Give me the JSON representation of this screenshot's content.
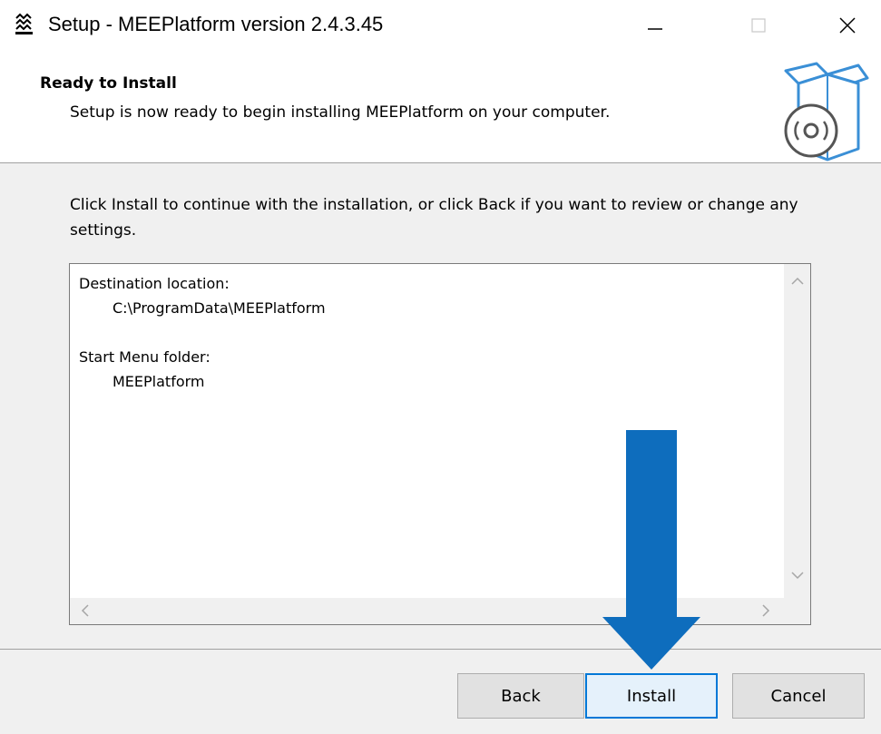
{
  "window": {
    "title": "Setup - MEEPlatform version 2.4.3.45",
    "icon": "app-logo-icon",
    "controls": [
      "minimize-icon",
      "maximize-icon",
      "close-icon"
    ]
  },
  "header": {
    "title": "Ready to Install",
    "subtitle": "Setup is now ready to begin installing MEEPlatform on your computer.",
    "icon": "install-box-disc-icon"
  },
  "body": {
    "instructions": "Click Install to continue with the installation, or click Back if you want to review or change any settings."
  },
  "memo": {
    "destination_label": "Destination location:",
    "destination_value": "C:\\ProgramData\\MEEPlatform",
    "start_menu_label": "Start Menu folder:",
    "start_menu_value": "MEEPlatform"
  },
  "buttons": {
    "back": "Back",
    "install": "Install",
    "cancel": "Cancel"
  },
  "colors": {
    "accent": "#0078d7",
    "arrow": "#0e6dbd"
  }
}
